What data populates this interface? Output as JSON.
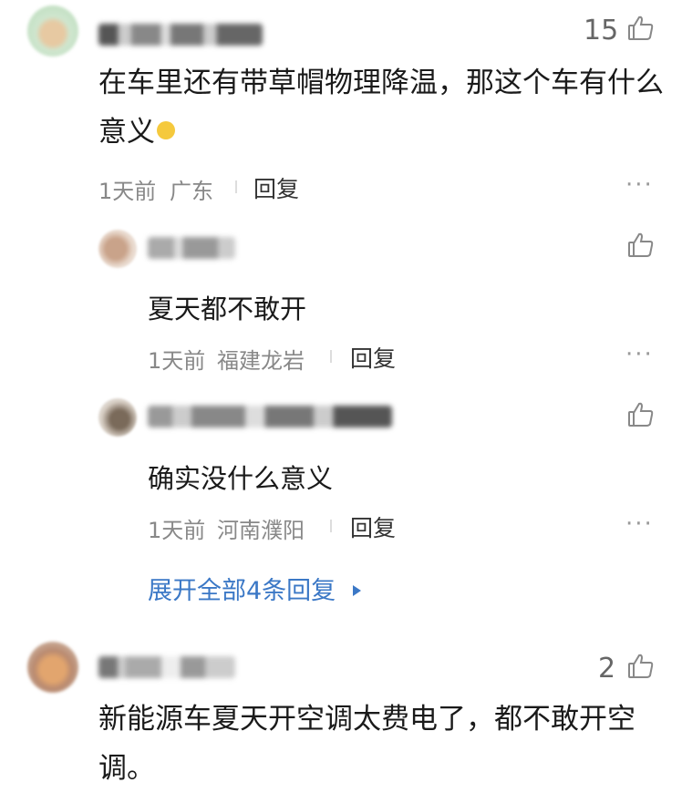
{
  "comments": [
    {
      "likes": "15",
      "content": "在车里还有带草帽物理降温，那这个车有什么意义",
      "time": "1天前",
      "location": "广东",
      "reply": "回复",
      "more": "···",
      "replies": [
        {
          "content": "夏天都不敢开",
          "time": "1天前",
          "location": "福建龙岩",
          "reply": "回复",
          "more": "···"
        },
        {
          "content": "确实没什么意义",
          "time": "1天前",
          "location": "河南濮阳",
          "reply": "回复",
          "more": "···"
        }
      ],
      "expand": "展开全部4条回复"
    },
    {
      "likes": "2",
      "content": "新能源车夏天开空调太费电了，都不敢开空调。"
    }
  ],
  "icons": {
    "like": "thumbs-up-icon",
    "expand_arrow": "triangle-right-icon",
    "emoji": "laughing-emoji-icon"
  },
  "colors": {
    "link": "#3b78c6",
    "meta": "#888888"
  }
}
